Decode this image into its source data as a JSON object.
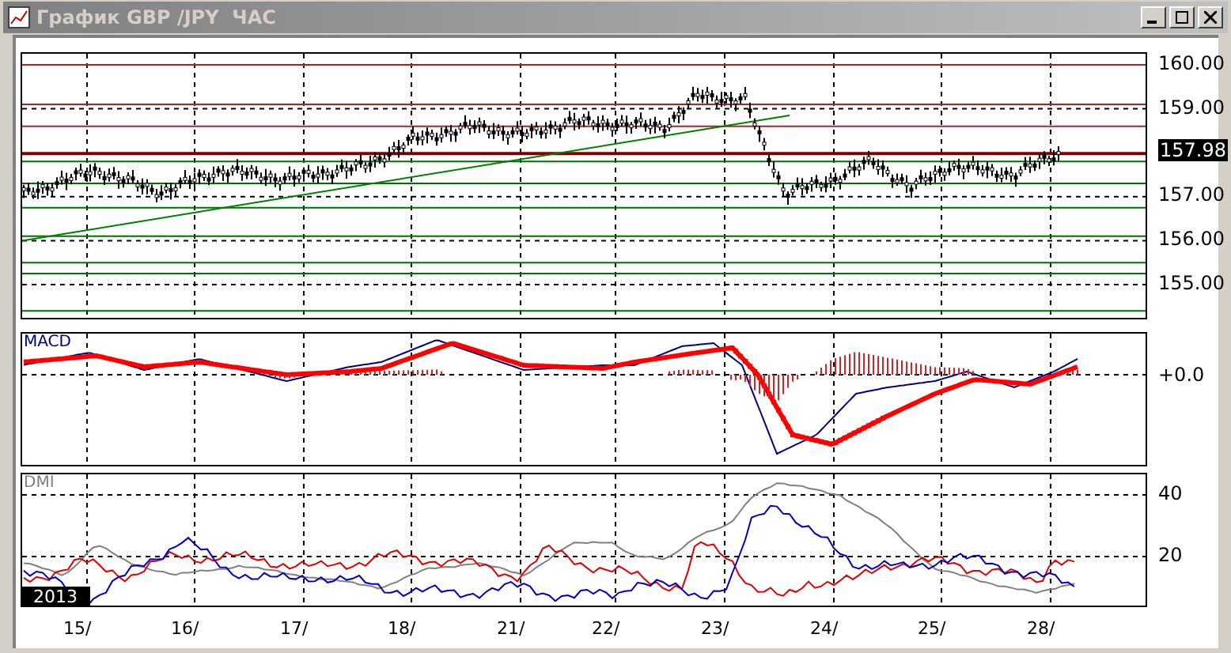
{
  "window": {
    "title": "График GBP /JPY  ЧАС"
  },
  "price_panel": {
    "axis_labels": [
      "160.00",
      "159.00",
      "157.00",
      "156.00",
      "155.00"
    ],
    "current_price": "157.98"
  },
  "macd_panel": {
    "title": "MACD",
    "axis_label": "+0.0"
  },
  "dmi_panel": {
    "title": "DMI",
    "axis_labels": [
      "40",
      "20"
    ],
    "year": "2013"
  },
  "dates": [
    "15/",
    "16/",
    "17/",
    "18/",
    "21/",
    "22/",
    "23/",
    "24/",
    "25/",
    "28/"
  ]
}
